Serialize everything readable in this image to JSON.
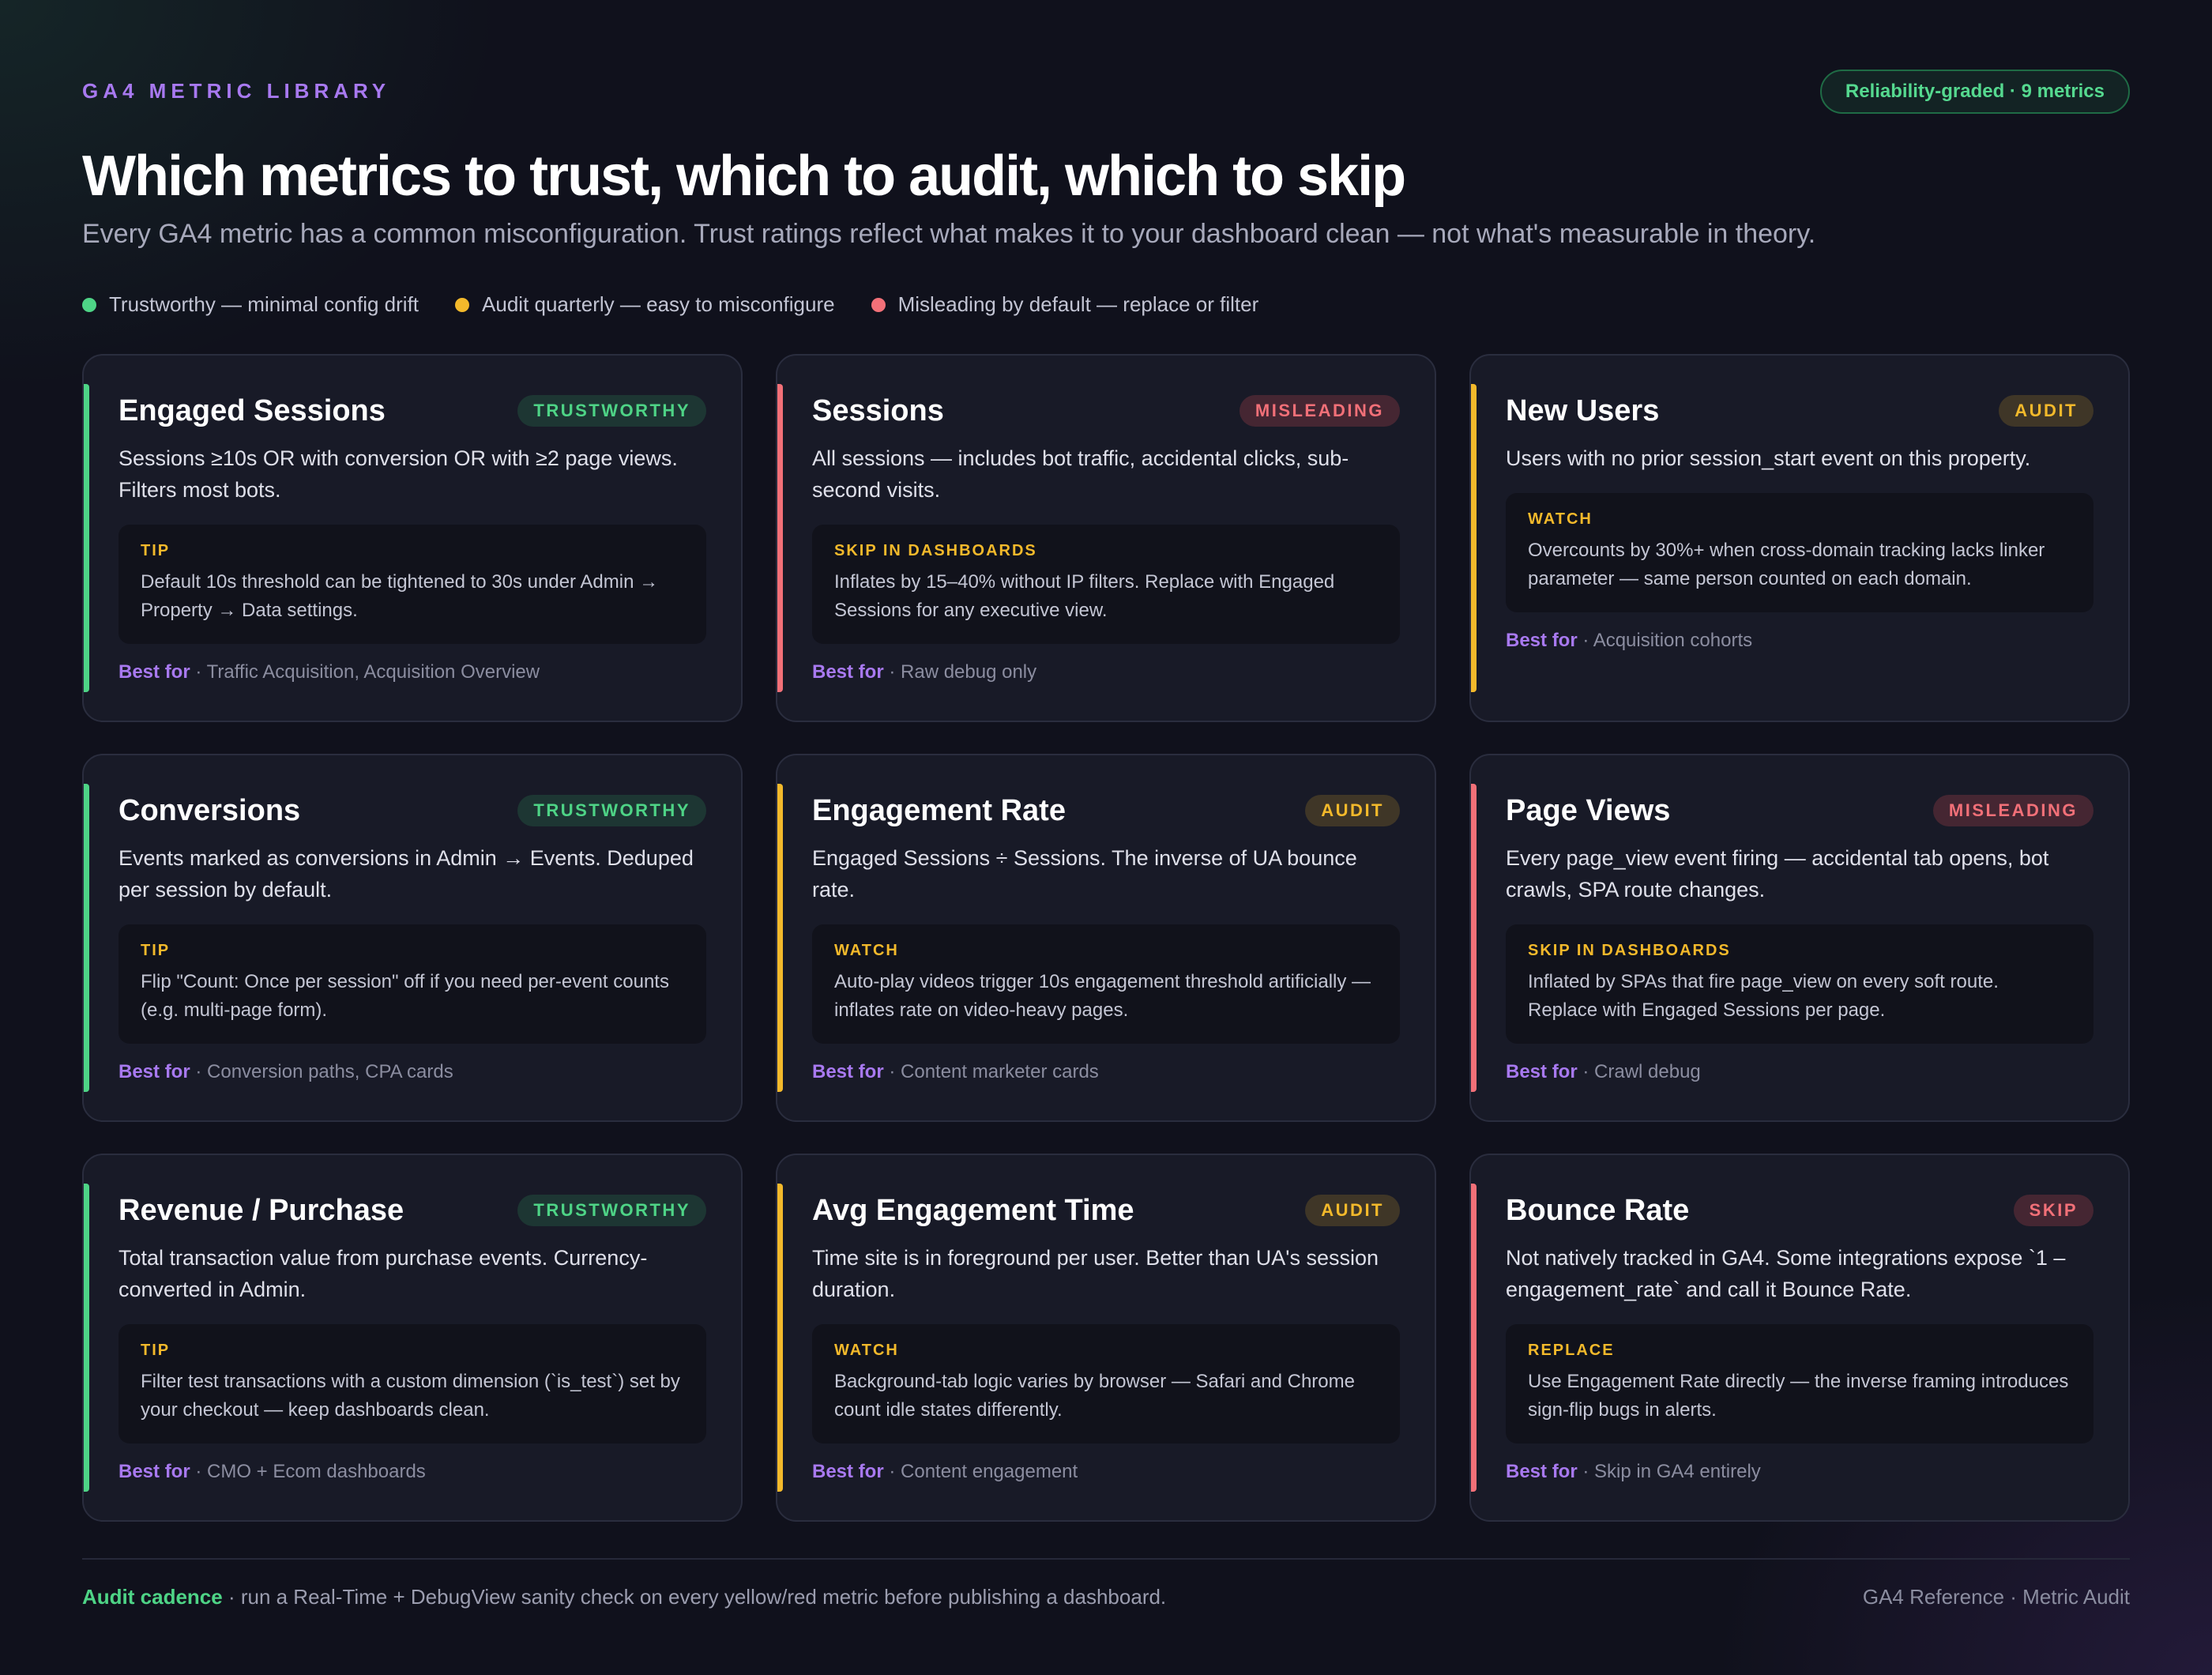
{
  "header": {
    "eyebrow": "GA4 METRIC LIBRARY",
    "pill": "Reliability-graded · 9 metrics",
    "title": "Which metrics to trust, which to audit, which to skip",
    "subtitle": "Every GA4 metric has a common misconfiguration. Trust ratings reflect what makes it to your dashboard clean — not what's measurable in theory."
  },
  "legend": [
    {
      "label": "Trustworthy — minimal config drift",
      "color": "#4ed486"
    },
    {
      "label": "Audit quarterly — easy to misconfigure",
      "color": "#f3b92b"
    },
    {
      "label": "Misleading by default — replace or filter",
      "color": "#f27078"
    }
  ],
  "best_for_label": "Best for",
  "cards": [
    {
      "title": "Engaged Sessions",
      "badge": "TRUSTWORTHY",
      "kind": "trust",
      "desc": "Sessions ≥10s OR with conversion OR with ≥2 page views. Filters most bots.",
      "note_label": "TIP",
      "note": "Default 10s threshold can be tightened to 30s under Admin → Property → Data settings.",
      "best_for": " · Traffic Acquisition, Acquisition Overview"
    },
    {
      "title": "Sessions",
      "badge": "MISLEADING",
      "kind": "mis",
      "desc": "All sessions — includes bot traffic, accidental clicks, sub-second visits.",
      "note_label": "SKIP IN DASHBOARDS",
      "note": "Inflates by 15–40% without IP filters. Replace with Engaged Sessions for any executive view.",
      "best_for": " · Raw debug only"
    },
    {
      "title": "New Users",
      "badge": "AUDIT",
      "kind": "audit",
      "desc": "Users with no prior session_start event on this property.",
      "note_label": "WATCH",
      "note": "Overcounts by 30%+ when cross-domain tracking lacks linker parameter — same person counted on each domain.",
      "best_for": " · Acquisition cohorts"
    },
    {
      "title": "Conversions",
      "badge": "TRUSTWORTHY",
      "kind": "trust",
      "desc": "Events marked as conversions in Admin → Events. Deduped per session by default.",
      "note_label": "TIP",
      "note": "Flip \"Count: Once per session\" off if you need per-event counts (e.g. multi-page form).",
      "best_for": " · Conversion paths, CPA cards"
    },
    {
      "title": "Engagement Rate",
      "badge": "AUDIT",
      "kind": "audit",
      "desc": "Engaged Sessions ÷ Sessions. The inverse of UA bounce rate.",
      "note_label": "WATCH",
      "note": "Auto-play videos trigger 10s engagement threshold artificially — inflates rate on video-heavy pages.",
      "best_for": " · Content marketer cards"
    },
    {
      "title": "Page Views",
      "badge": "MISLEADING",
      "kind": "mis",
      "desc": "Every page_view event firing — accidental tab opens, bot crawls, SPA route changes.",
      "note_label": "SKIP IN DASHBOARDS",
      "note": "Inflated by SPAs that fire page_view on every soft route. Replace with Engaged Sessions per page.",
      "best_for": " · Crawl debug"
    },
    {
      "title": "Revenue / Purchase",
      "badge": "TRUSTWORTHY",
      "kind": "trust",
      "desc": "Total transaction value from purchase events. Currency-converted in Admin.",
      "note_label": "TIP",
      "note": "Filter test transactions with a custom dimension (`is_test`) set by your checkout — keep dashboards clean.",
      "best_for": " · CMO + Ecom dashboards"
    },
    {
      "title": "Avg Engagement Time",
      "badge": "AUDIT",
      "kind": "audit",
      "desc": "Time site is in foreground per user. Better than UA's session duration.",
      "note_label": "WATCH",
      "note": "Background-tab logic varies by browser — Safari and Chrome count idle states differently.",
      "best_for": " · Content engagement"
    },
    {
      "title": "Bounce Rate",
      "badge": "SKIP",
      "kind": "mis",
      "desc": "Not natively tracked in GA4. Some integrations expose `1 – engagement_rate` and call it Bounce Rate.",
      "note_label": "REPLACE",
      "note": "Use Engagement Rate directly — the inverse framing introduces sign-flip bugs in alerts.",
      "best_for": " · Skip in GA4 entirely"
    }
  ],
  "footer": {
    "cadence_label": "Audit cadence",
    "cadence_text": " · run a Real-Time + DebugView sanity check on every yellow/red metric before publishing a dashboard.",
    "right": "GA4 Reference · Metric Audit"
  },
  "colors": {
    "trust": "#4ed486",
    "audit": "#f3b92b",
    "mis": "#f27078",
    "accent": "#a879f0"
  }
}
